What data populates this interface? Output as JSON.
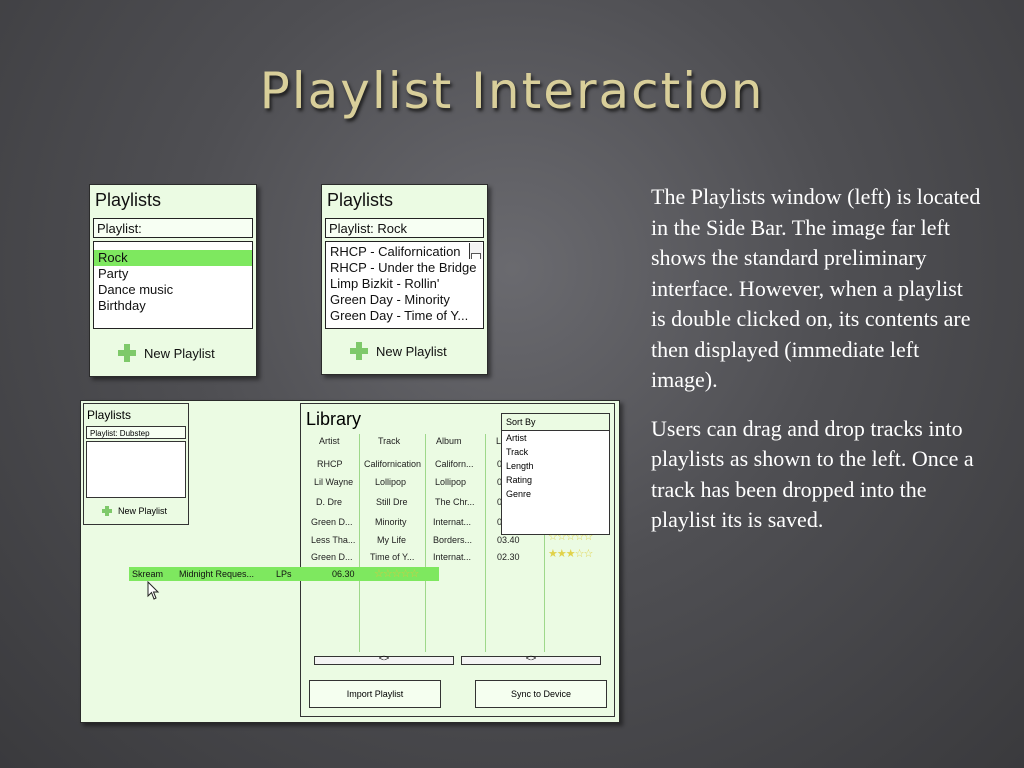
{
  "slide": {
    "title": "Playlist Interaction",
    "paragraphs": [
      "The Playlists window (left) is located in the Side Bar. The image far left shows the standard preliminary interface. However, when a playlist is double clicked on, its contents are then displayed (immediate left image).",
      "Users can drag and drop tracks into playlists as shown to the left. Once a track has been dropped into the playlist its is saved."
    ]
  },
  "panel1": {
    "header": "Playlists",
    "field": "Playlist:",
    "items": [
      "Rock",
      "Party",
      "Dance music",
      "Birthday"
    ],
    "selected_index": 0,
    "new_button": "New Playlist"
  },
  "panel2": {
    "header": "Playlists",
    "field": "Playlist: Rock",
    "items": [
      "RHCP - Californication",
      "RHCP - Under the Bridge",
      "Limp Bizkit - Rollin'",
      "Green Day - Minority",
      "Green Day - Time of Y..."
    ],
    "new_button": "New Playlist"
  },
  "library_shot": {
    "mini": {
      "header": "Playlists",
      "field": "Playlist: Dubstep",
      "new_button": "New Playlist"
    },
    "title": "Library",
    "columns": [
      "Artist",
      "Track",
      "Album",
      "L"
    ],
    "rows": [
      {
        "artist": "RHCP",
        "track": "Californication",
        "album": "Californ...",
        "length": "0"
      },
      {
        "artist": "Lil Wayne",
        "track": "Lollipop",
        "album": "Lollipop",
        "length": "0"
      },
      {
        "artist": "D. Dre",
        "track": "Still Dre",
        "album": "The Chr...",
        "length": "0"
      },
      {
        "artist": "Green D...",
        "track": "Minority",
        "album": "Internat...",
        "length": "0"
      },
      {
        "artist": "Less Tha...",
        "track": "My Life",
        "album": "Borders...",
        "length": "03.40"
      },
      {
        "artist": "Green D...",
        "track": "Time of Y...",
        "album": "Internat...",
        "length": "02.30"
      }
    ],
    "sort_by": {
      "header": "Sort By",
      "options": [
        "Artist",
        "Track",
        "Length",
        "Rating",
        "Genre"
      ]
    },
    "ratings": [
      "☆☆☆☆☆",
      "★★★☆☆",
      "★★★☆☆"
    ],
    "dragged": {
      "artist": "Skream",
      "track": "Midnight Reques...",
      "album": "LPs",
      "length": "06.30",
      "stars": "☆☆☆☆☆"
    },
    "scroll_arrows": "<>",
    "buttons": {
      "import": "Import Playlist",
      "sync": "Sync to Device"
    }
  },
  "colors": {
    "panel_bg": "#ebfbe3",
    "selection_green": "#7ee85f",
    "title_gold": "#d9cf9a"
  }
}
